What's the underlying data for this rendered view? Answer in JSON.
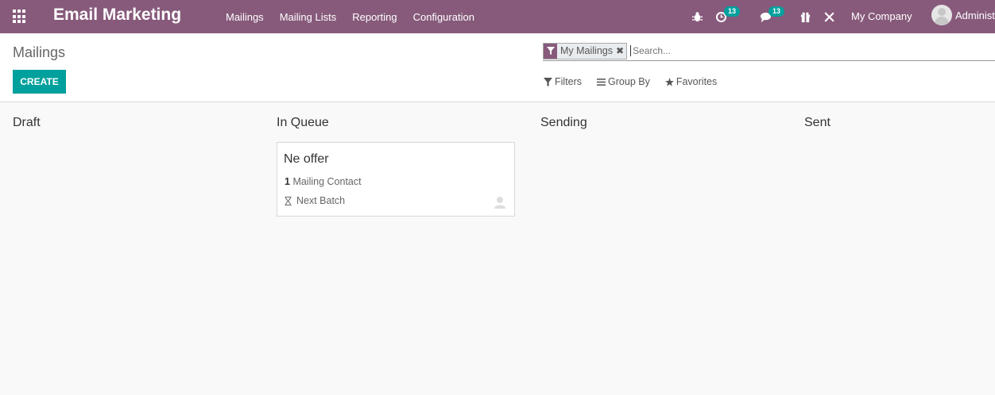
{
  "navbar": {
    "app_title": "Email Marketing",
    "menu": [
      "Mailings",
      "Mailing Lists",
      "Reporting",
      "Configuration"
    ],
    "activity_count": "13",
    "messages_count": "13",
    "company": "My Company",
    "user": "Administrator"
  },
  "control_panel": {
    "breadcrumb": "Mailings",
    "create_label": "CREATE",
    "search": {
      "facet": "My Mailings",
      "facet_remove": "✖",
      "placeholder": "Search..."
    },
    "options": {
      "filters": "Filters",
      "group_by": "Group By",
      "favorites": "Favorites"
    }
  },
  "kanban": {
    "columns": [
      {
        "title": "Draft"
      },
      {
        "title": "In Queue"
      },
      {
        "title": "Sending"
      },
      {
        "title": "Sent"
      }
    ],
    "card": {
      "title": "Ne offer",
      "contact_count": "1",
      "contact_label": "Mailing Contact",
      "batch_label": "Next Batch"
    }
  },
  "colors": {
    "brand": "#875a7b",
    "primary": "#00a09d"
  }
}
